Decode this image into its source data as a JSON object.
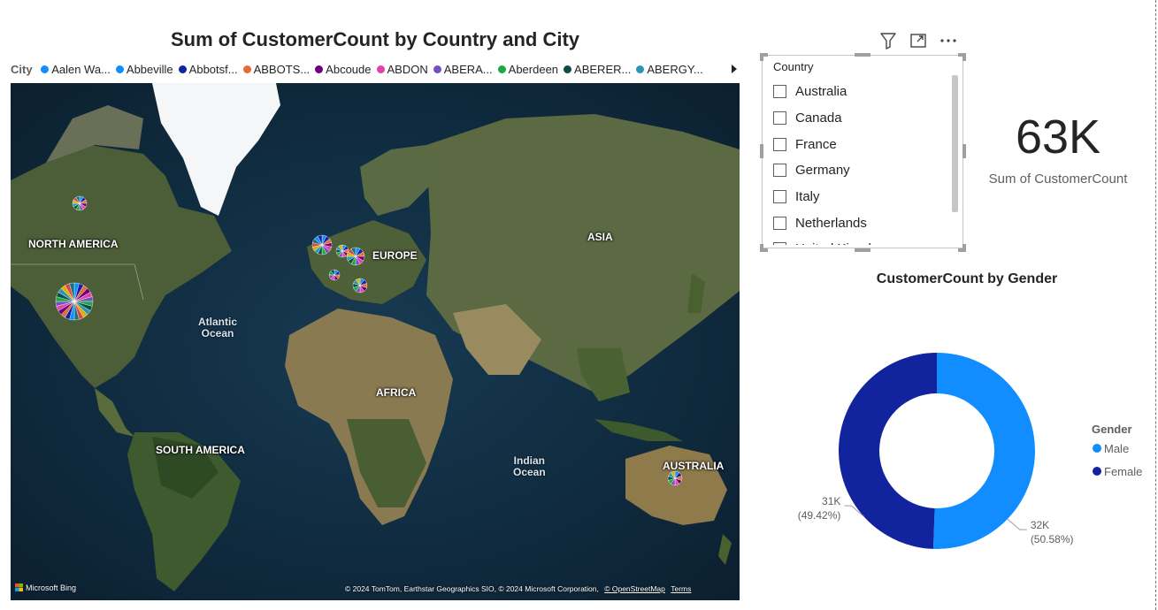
{
  "map": {
    "title": "Sum of CustomerCount by Country and City",
    "legend": {
      "title": "City",
      "items": [
        {
          "label": "Aalen Wa...",
          "color": "#118dff"
        },
        {
          "label": "Abbeville",
          "color": "#118dff"
        },
        {
          "label": "Abbotsf...",
          "color": "#12239e"
        },
        {
          "label": "ABBOTS...",
          "color": "#e66c37"
        },
        {
          "label": "Abcoude",
          "color": "#6b007b"
        },
        {
          "label": "ABDON",
          "color": "#e044a7"
        },
        {
          "label": "ABERA...",
          "color": "#744ec2"
        },
        {
          "label": "Aberdeen",
          "color": "#1aab40"
        },
        {
          "label": "ABERER...",
          "color": "#0e4d45"
        },
        {
          "label": "ABERGY...",
          "color": "#2e94b7"
        }
      ],
      "next_icon": "chevron-right-icon"
    },
    "region_labels": {
      "north_america": "NORTH AMERICA",
      "europe": "EUROPE",
      "asia": "ASIA",
      "africa": "AFRICA",
      "south_america": "SOUTH AMERICA",
      "australia": "AUSTRALIA"
    },
    "ocean_labels": {
      "atlantic": "Atlantic\nOcean",
      "indian": "Indian\nOcean"
    },
    "bing_logo": "Microsoft Bing",
    "attribution": "© 2024 TomTom, Earthstar Geographics SIO, © 2024 Microsoft Corporation,",
    "osm_link": "© OpenStreetMap",
    "terms_link": "Terms"
  },
  "slicer": {
    "title": "Country",
    "options": [
      "Australia",
      "Canada",
      "France",
      "Germany",
      "Italy",
      "Netherlands",
      "United Kingdom"
    ],
    "toolbar_icons": [
      "filter-icon",
      "focus-mode-icon",
      "more-options-icon"
    ]
  },
  "card": {
    "value": "63K",
    "label": "Sum of CustomerCount"
  },
  "donut": {
    "title": "CustomerCount by Gender",
    "legend_title": "Gender"
  },
  "chart_data": {
    "type": "pie",
    "title": "CustomerCount by Gender",
    "legend_title": "Gender",
    "series": [
      {
        "name": "Male",
        "value": 32,
        "label": "32K",
        "pct": "(50.58%)",
        "percent": 50.58,
        "color": "#118dff"
      },
      {
        "name": "Female",
        "value": 31,
        "label": "31K",
        "pct": "(49.42%)",
        "percent": 49.42,
        "color": "#12239e"
      }
    ],
    "legend_position": "right"
  }
}
